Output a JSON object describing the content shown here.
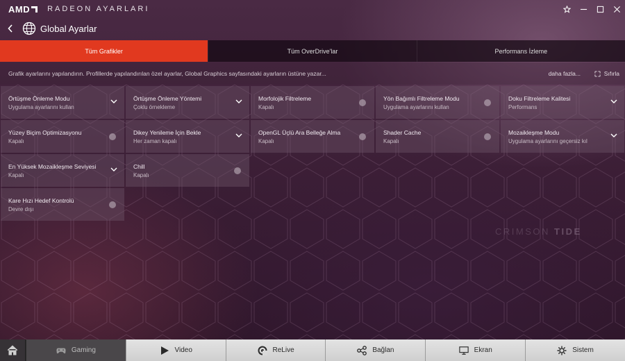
{
  "app": {
    "brand": "AMD",
    "title": "RADEON AYARLARI"
  },
  "header": {
    "title": "Global Ayarlar"
  },
  "tabs": [
    {
      "label": "Tüm Grafikler",
      "active": true
    },
    {
      "label": "Tüm OverDrive'lar",
      "active": false
    },
    {
      "label": "Performans İzleme",
      "active": false
    }
  ],
  "info": {
    "text": "Grafik ayarlarını yapılandırın. Profillerde yapılandırılan özel ayarlar, Global Graphics sayfasındaki ayarların üstüne yazar...",
    "more_label": "daha fazla...",
    "reset_label": "Sıfırla"
  },
  "settings": [
    {
      "name": "Örtüşme Önleme Modu",
      "value": "Uygulama ayarlarını kullan",
      "control": "dropdown"
    },
    {
      "name": "Örtüşme Önleme Yöntemi",
      "value": "Çoklu örnekleme",
      "control": "dropdown"
    },
    {
      "name": "Morfolojik Filtreleme",
      "value": "Kapalı",
      "control": "toggle"
    },
    {
      "name": "Yön Bağımlı Filtreleme Modu",
      "value": "Uygulama ayarlarını kullan",
      "control": "toggle"
    },
    {
      "name": "Doku Filtreleme Kalitesi",
      "value": "Performans",
      "control": "dropdown"
    },
    {
      "name": "Yüzey Biçim Optimizasyonu",
      "value": "Kapalı",
      "control": "toggle"
    },
    {
      "name": "Dikey Yenileme İçin Bekle",
      "value": "Her zaman kapalı",
      "control": "dropdown"
    },
    {
      "name": "OpenGL Üçlü Ara Belleğe Alma",
      "value": "Kapalı",
      "control": "toggle"
    },
    {
      "name": "Shader Cache",
      "value": "Kapalı",
      "control": "toggle"
    },
    {
      "name": "Mozaikleşme Modu",
      "value": "Uygulama ayarlarını geçersiz kıl",
      "control": "dropdown"
    },
    {
      "name": "En Yüksek Mozaikleşme Seviyesi",
      "value": "Kapalı",
      "control": "dropdown"
    },
    {
      "name": "Chill",
      "value": "Kapalı",
      "control": "toggle"
    },
    {
      "name": "Kare Hızı Hedef Kontrolü",
      "value": "Devre dışı",
      "control": "toggle"
    }
  ],
  "watermark": {
    "light": "CRIMSON",
    "bold": "TIDE"
  },
  "bottom_nav": [
    {
      "label": "Gaming",
      "icon": "gamepad-icon",
      "active": true
    },
    {
      "label": "Video",
      "icon": "play-icon",
      "active": false
    },
    {
      "label": "ReLive",
      "icon": "relive-icon",
      "active": false
    },
    {
      "label": "Bağlan",
      "icon": "connect-icon",
      "active": false
    },
    {
      "label": "Ekran",
      "icon": "monitor-icon",
      "active": false
    },
    {
      "label": "Sistem",
      "icon": "system-icon",
      "active": false
    }
  ],
  "colors": {
    "accent": "#e1391f",
    "background": "#3e2038"
  }
}
